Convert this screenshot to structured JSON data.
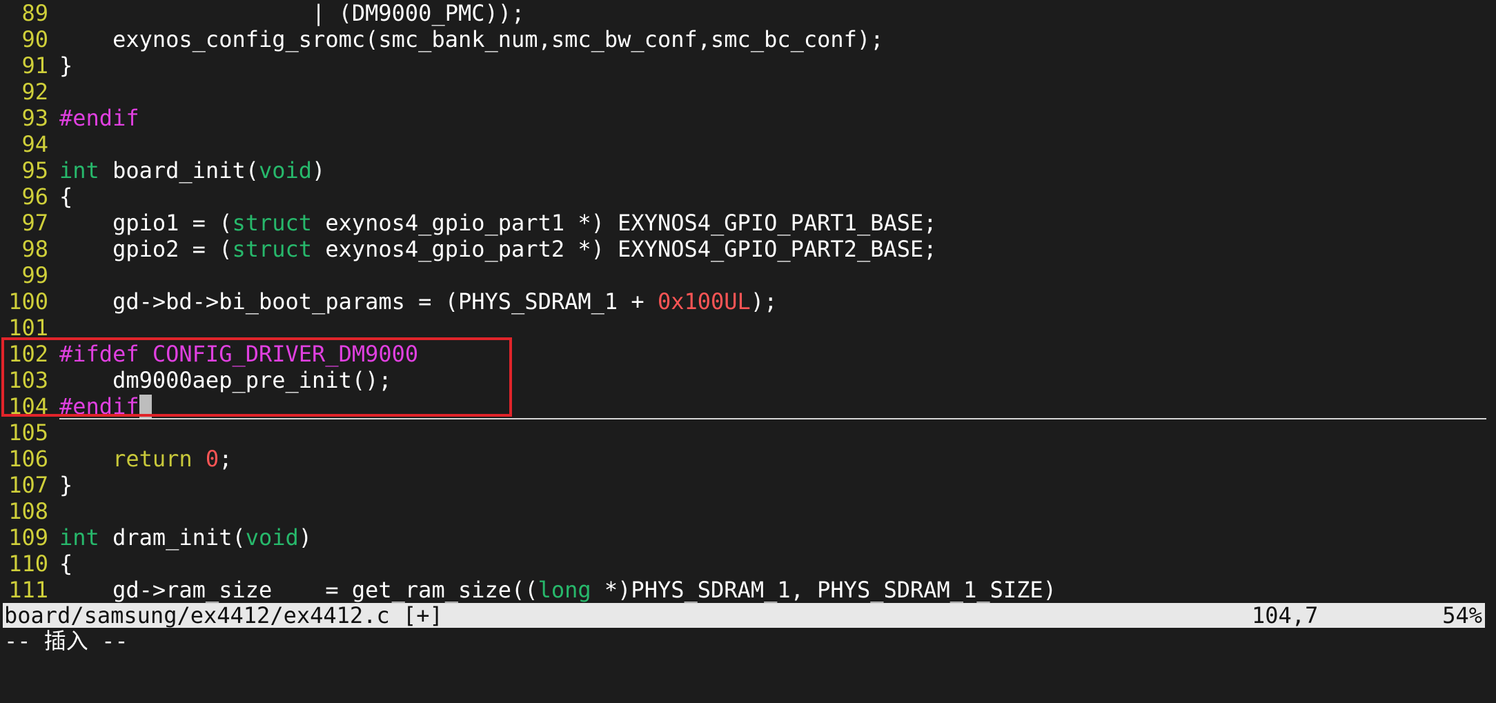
{
  "colors": {
    "background": "#1c1c1c",
    "line_number": "#cfcf3a",
    "type_keyword": "#27b86b",
    "preprocessor": "#e040e0",
    "number_literal": "#ff5555",
    "statement": "#c8c83a",
    "highlight_box": "#e0242a"
  },
  "lines": [
    {
      "num": "89",
      "tokens": [
        {
          "t": "                   | (DM9000_PMC));",
          "c": "plain"
        }
      ]
    },
    {
      "num": "90",
      "tokens": [
        {
          "t": "    exynos_config_sromc(smc_bank_num,smc_bw_conf,smc_bc_conf);",
          "c": "plain"
        }
      ]
    },
    {
      "num": "91",
      "tokens": [
        {
          "t": "}",
          "c": "plain"
        }
      ]
    },
    {
      "num": "92",
      "tokens": []
    },
    {
      "num": "93",
      "tokens": [
        {
          "t": "#endif",
          "c": "pre"
        }
      ]
    },
    {
      "num": "94",
      "tokens": []
    },
    {
      "num": "95",
      "tokens": [
        {
          "t": "int",
          "c": "type"
        },
        {
          "t": " board_init(",
          "c": "plain"
        },
        {
          "t": "void",
          "c": "type"
        },
        {
          "t": ")",
          "c": "plain"
        }
      ]
    },
    {
      "num": "96",
      "tokens": [
        {
          "t": "{",
          "c": "plain"
        }
      ]
    },
    {
      "num": "97",
      "tokens": [
        {
          "t": "    gpio1 = (",
          "c": "plain"
        },
        {
          "t": "struct",
          "c": "type"
        },
        {
          "t": " exynos4_gpio_part1 *) EXYNOS4_GPIO_PART1_BASE;",
          "c": "plain"
        }
      ]
    },
    {
      "num": "98",
      "tokens": [
        {
          "t": "    gpio2 = (",
          "c": "plain"
        },
        {
          "t": "struct",
          "c": "type"
        },
        {
          "t": " exynos4_gpio_part2 *) EXYNOS4_GPIO_PART2_BASE;",
          "c": "plain"
        }
      ]
    },
    {
      "num": "99",
      "tokens": []
    },
    {
      "num": "100",
      "tokens": [
        {
          "t": "    gd->bd->bi_boot_params = (PHYS_SDRAM_1 + ",
          "c": "plain"
        },
        {
          "t": "0x100UL",
          "c": "num"
        },
        {
          "t": ");",
          "c": "plain"
        }
      ]
    },
    {
      "num": "101",
      "tokens": []
    },
    {
      "num": "102",
      "tokens": [
        {
          "t": "#ifdef CONFIG_DRIVER_DM9000",
          "c": "pre"
        }
      ]
    },
    {
      "num": "103",
      "tokens": [
        {
          "t": "    dm9000aep_pre_init();",
          "c": "plain"
        }
      ]
    },
    {
      "num": "104",
      "tokens": [
        {
          "t": "#endif",
          "c": "pre"
        }
      ],
      "cursor": true
    },
    {
      "num": "105",
      "tokens": []
    },
    {
      "num": "106",
      "tokens": [
        {
          "t": "    ",
          "c": "plain"
        },
        {
          "t": "return",
          "c": "stmt"
        },
        {
          "t": " ",
          "c": "plain"
        },
        {
          "t": "0",
          "c": "num"
        },
        {
          "t": ";",
          "c": "plain"
        }
      ]
    },
    {
      "num": "107",
      "tokens": [
        {
          "t": "}",
          "c": "plain"
        }
      ]
    },
    {
      "num": "108",
      "tokens": []
    },
    {
      "num": "109",
      "tokens": [
        {
          "t": "int",
          "c": "type"
        },
        {
          "t": " dram_init(",
          "c": "plain"
        },
        {
          "t": "void",
          "c": "type"
        },
        {
          "t": ")",
          "c": "plain"
        }
      ]
    },
    {
      "num": "110",
      "tokens": [
        {
          "t": "{",
          "c": "plain"
        }
      ]
    },
    {
      "num": "111",
      "tokens": [
        {
          "t": "    gd->ram_size    = get_ram_size((",
          "c": "plain"
        },
        {
          "t": "long",
          "c": "type"
        },
        {
          "t": " *)PHYS_SDRAM_1, PHYS_SDRAM_1_SIZE)",
          "c": "plain"
        }
      ]
    }
  ],
  "statusline": {
    "file": "board/samsung/ex4412/ex4412.c [+]",
    "position": "104,7",
    "percent": "54%"
  },
  "mode": "-- 插入 --"
}
